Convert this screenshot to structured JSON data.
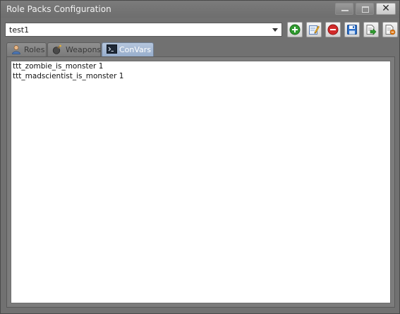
{
  "window": {
    "title": "Role Packs Configuration"
  },
  "toolbar": {
    "selected_pack": "test1",
    "buttons": [
      {
        "icon": "add-icon"
      },
      {
        "icon": "edit-icon"
      },
      {
        "icon": "remove-icon"
      },
      {
        "icon": "save-icon"
      },
      {
        "icon": "import-icon"
      },
      {
        "icon": "export-icon"
      }
    ]
  },
  "tabs": [
    {
      "label": "Roles",
      "icon": "user-icon",
      "active": false
    },
    {
      "label": "Weapons",
      "icon": "bomb-icon",
      "active": false
    },
    {
      "label": "ConVars",
      "icon": "console-icon",
      "active": true
    }
  ],
  "convars": {
    "lines": [
      "ttt_zombie_is_monster 1",
      "ttt_madscientist_is_monster 1"
    ]
  },
  "colors": {
    "title_bg": "#717171",
    "active_tab": "#97adcc",
    "add_green": "#2f9a2f",
    "remove_red": "#d22a2a",
    "save_blue": "#2c6fc9"
  }
}
